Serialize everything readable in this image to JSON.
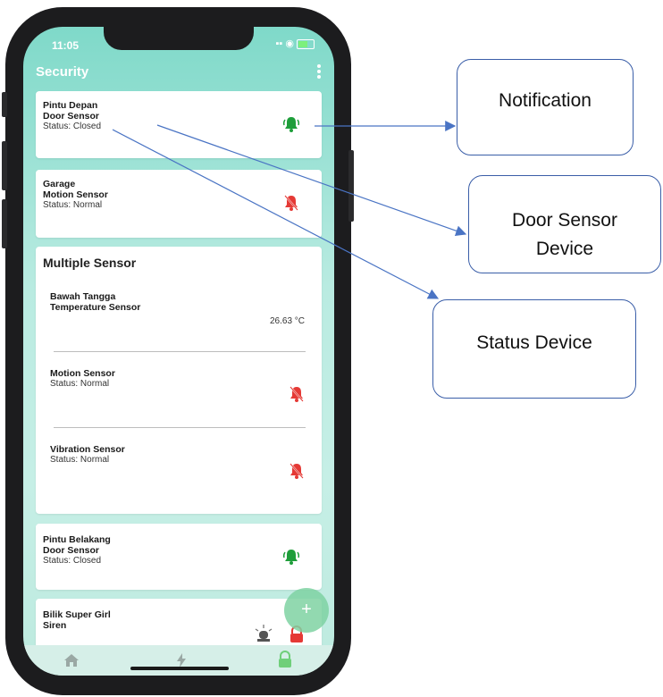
{
  "statusbar": {
    "time": "11:05"
  },
  "header": {
    "title": "Security"
  },
  "cards": [
    {
      "name": "Pintu Depan",
      "type": "Door Sensor",
      "status": "Status: Closed",
      "icon": "bell-on-icon"
    },
    {
      "name": "Garage",
      "type": "Motion Sensor",
      "status": "Status: Normal",
      "icon": "bell-off-icon"
    }
  ],
  "multi": {
    "title": "Multiple Sensor",
    "temp_name": "Bawah Tangga",
    "temp_type": "Temperature Sensor",
    "temp_value": "26.63 °C",
    "motion_name": "Motion Sensor",
    "motion_status": "Status: Normal",
    "vibration_name": "Vibration Sensor",
    "vibration_status": "Status: Normal"
  },
  "cards2": [
    {
      "name": "Pintu Belakang",
      "type": "Door Sensor",
      "status": "Status: Closed",
      "icon": "bell-on-icon"
    },
    {
      "name": "Bilik Super Girl",
      "type": "Siren",
      "icon": "siren-icon"
    }
  ],
  "fab": {
    "label": "+"
  },
  "tabs": [
    {
      "name": "home-icon"
    },
    {
      "name": "flash-icon"
    },
    {
      "name": "lock-icon"
    }
  ],
  "callouts": {
    "notification": "Notification",
    "door_sensor_line1": "Door Sensor",
    "door_sensor_line2": "Device",
    "status_device": "Status Device"
  },
  "colors": {
    "accent": "#7fd9c9",
    "bell_on": "#1e9e3a",
    "bell_off": "#e53935",
    "callout_border": "#3a5ea8"
  }
}
